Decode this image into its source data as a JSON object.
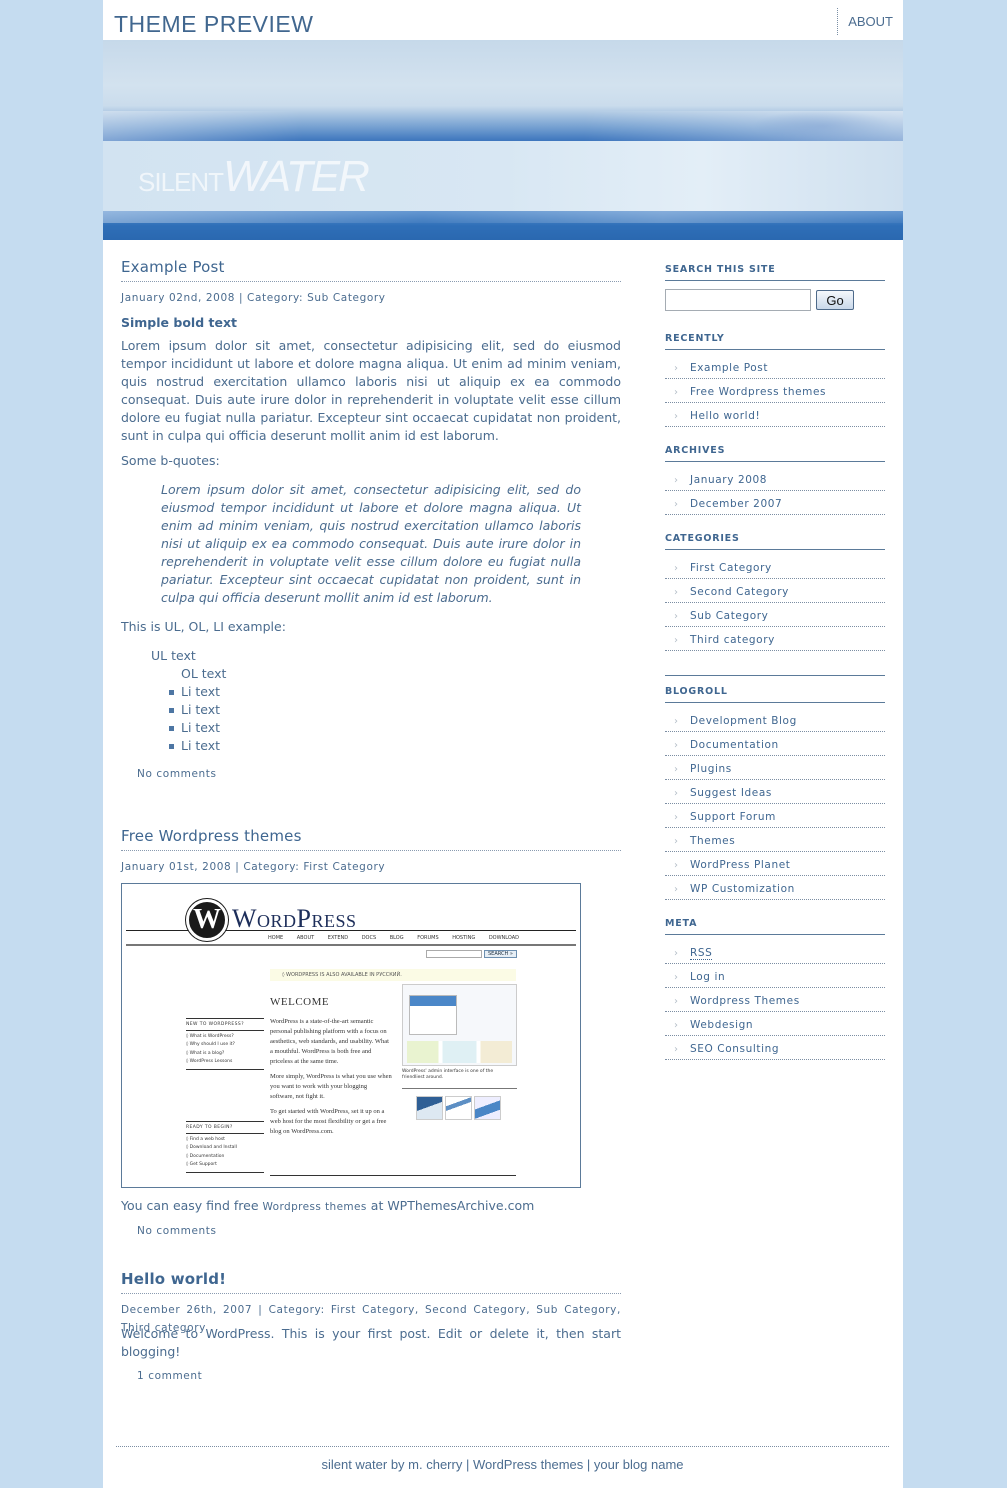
{
  "header": {
    "site_title": "THEME PREVIEW",
    "nav": [
      {
        "label": "ABOUT"
      }
    ]
  },
  "banner": {
    "logo_light": "SILENT",
    "logo_bold": "WATER"
  },
  "posts": [
    {
      "title": "Example Post",
      "date": "January 02nd, 2008",
      "category_label": "Category:",
      "categories": [
        "Sub Category"
      ],
      "bold_text": "Simple bold text",
      "paragraph": "Lorem ipsum dolor sit amet, consectetur adipisicing elit, sed do eiusmod tempor incididunt ut labore et dolore magna aliqua. Ut enim ad minim veniam, quis nostrud exercitation ullamco laboris nisi ut aliquip ex ea commodo consequat. Duis aute irure dolor in reprehenderit in voluptate velit esse cillum dolore eu fugiat nulla pariatur. Excepteur sint occaecat cupidatat non proident, sunt in culpa qui officia deserunt mollit anim id est laborum.",
      "bquote_intro": "Some b-quotes:",
      "blockquote": "Lorem ipsum dolor sit amet, consectetur adipisicing elit, sed do eiusmod tempor incididunt ut labore et dolore magna aliqua. Ut enim ad minim veniam, quis nostrud exercitation ullamco laboris nisi ut aliquip ex ea commodo consequat. Duis aute irure dolor in reprehenderit in voluptate velit esse cillum dolore eu fugiat nulla pariatur. Excepteur sint occaecat cupidatat non proident, sunt in culpa qui officia deserunt mollit anim id est laborum.",
      "list_intro": "This is UL, OL, LI example:",
      "ul_text": "UL text",
      "ol_text": "OL text",
      "li_items": [
        "Li text",
        "Li text",
        "Li text",
        "Li text"
      ],
      "comments": "No comments"
    },
    {
      "title": "Free Wordpress themes",
      "date": "January 01st, 2008",
      "category_label": "Category:",
      "categories": [
        "First Category"
      ],
      "body_prefix": "You can easy find free",
      "body_link": "Wordpress themes",
      "body_suffix": "at WPThemesArchive.com",
      "comments": "No comments",
      "screenshot": {
        "logo_letter": "W",
        "logo_text": "WordPress",
        "nav": [
          "HOME",
          "ABOUT",
          "EXTEND",
          "DOCS",
          "BLOG",
          "FORUMS",
          "HOSTING",
          "DOWNLOAD"
        ],
        "search_button": "SEARCH »",
        "notice": "◊ WORDPRESS IS ALSO AVAILABLE IN РУССКИЙ.",
        "welcome": "WELCOME",
        "body": [
          "WordPress is a state-of-the-art semantic personal publishing platform with a focus on aesthetics, web standards, and usability. What a mouthful. WordPress is both free and priceless at the same time.",
          "More simply, WordPress is what you use when you want to work with your blogging software, not fight it.",
          "To get started with WordPress, set it up on a web host for the most flexibility or get a free blog on WordPress.com."
        ],
        "side1_title": "NEW TO WORDPRESS?",
        "side1_items": [
          "◊ What is WordPress?",
          "◊ Why should I use it?",
          "◊ What is a blog?",
          "◊ WordPress Lessons"
        ],
        "side2_title": "READY TO BEGIN?",
        "side2_items": [
          "◊ Find a web host",
          "◊ Download and Install",
          "◊ Documentation",
          "◊ Get Support"
        ],
        "admin_caption": "WordPress' admin interface is one of the friendliest around."
      }
    },
    {
      "title": "Hello world!",
      "date": "December 26th, 2007",
      "category_label": "Category:",
      "categories": [
        "First Category",
        "Second Category",
        "Sub Category",
        "Third category"
      ],
      "paragraph": "Welcome to WordPress. This is your first post. Edit or delete it, then start blogging!",
      "comments": "1 comment"
    }
  ],
  "sidebar": {
    "search": {
      "title": "SEARCH THIS SITE",
      "value": "",
      "placeholder": "",
      "button": "Go"
    },
    "recently": {
      "title": "RECENTLY",
      "items": [
        "Example Post",
        "Free Wordpress themes",
        "Hello world!"
      ]
    },
    "archives": {
      "title": "ARCHIVES",
      "items": [
        "January 2008",
        "December 2007"
      ]
    },
    "categories": {
      "title": "CATEGORIES",
      "items": [
        "First Category",
        "Second Category",
        "Sub Category",
        "Third category"
      ]
    },
    "blogroll": {
      "title": "BLOGROLL",
      "items": [
        "Development Blog",
        "Documentation",
        "Plugins",
        "Suggest Ideas",
        "Support Forum",
        "Themes",
        "WordPress Planet",
        "WP Customization"
      ]
    },
    "meta": {
      "title": "META",
      "items": [
        "RSS",
        "Log in",
        "Wordpress Themes",
        "Webdesign",
        "SEO Consulting"
      ]
    }
  },
  "footer": {
    "credit": "silent water by m. cherry",
    "sep": "|",
    "link2": "WordPress themes",
    "link3": "your blog name"
  },
  "colors": {
    "page_bg": "#c5dcf0",
    "text": "#4b6c8f",
    "heading": "#3f6690",
    "banner_water": "#2f6fb8"
  }
}
